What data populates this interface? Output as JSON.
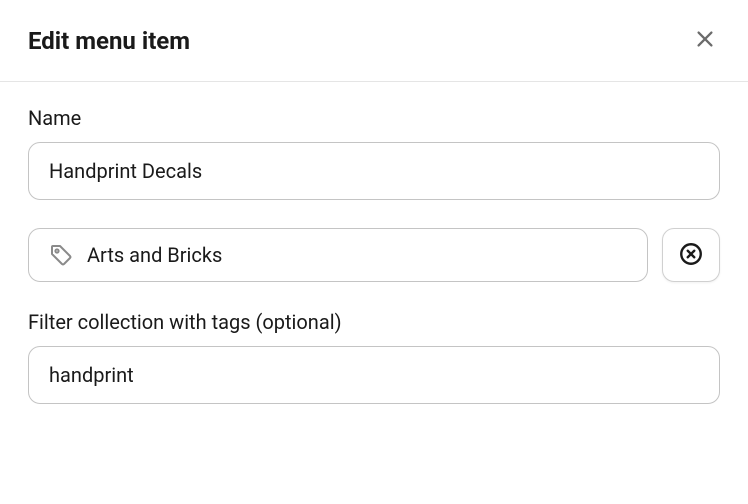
{
  "header": {
    "title": "Edit menu item"
  },
  "form": {
    "name": {
      "label": "Name",
      "value": "Handprint Decals"
    },
    "collection": {
      "value": "Arts and Bricks"
    },
    "tags": {
      "label": "Filter collection with tags (optional)",
      "value": "handprint"
    }
  }
}
